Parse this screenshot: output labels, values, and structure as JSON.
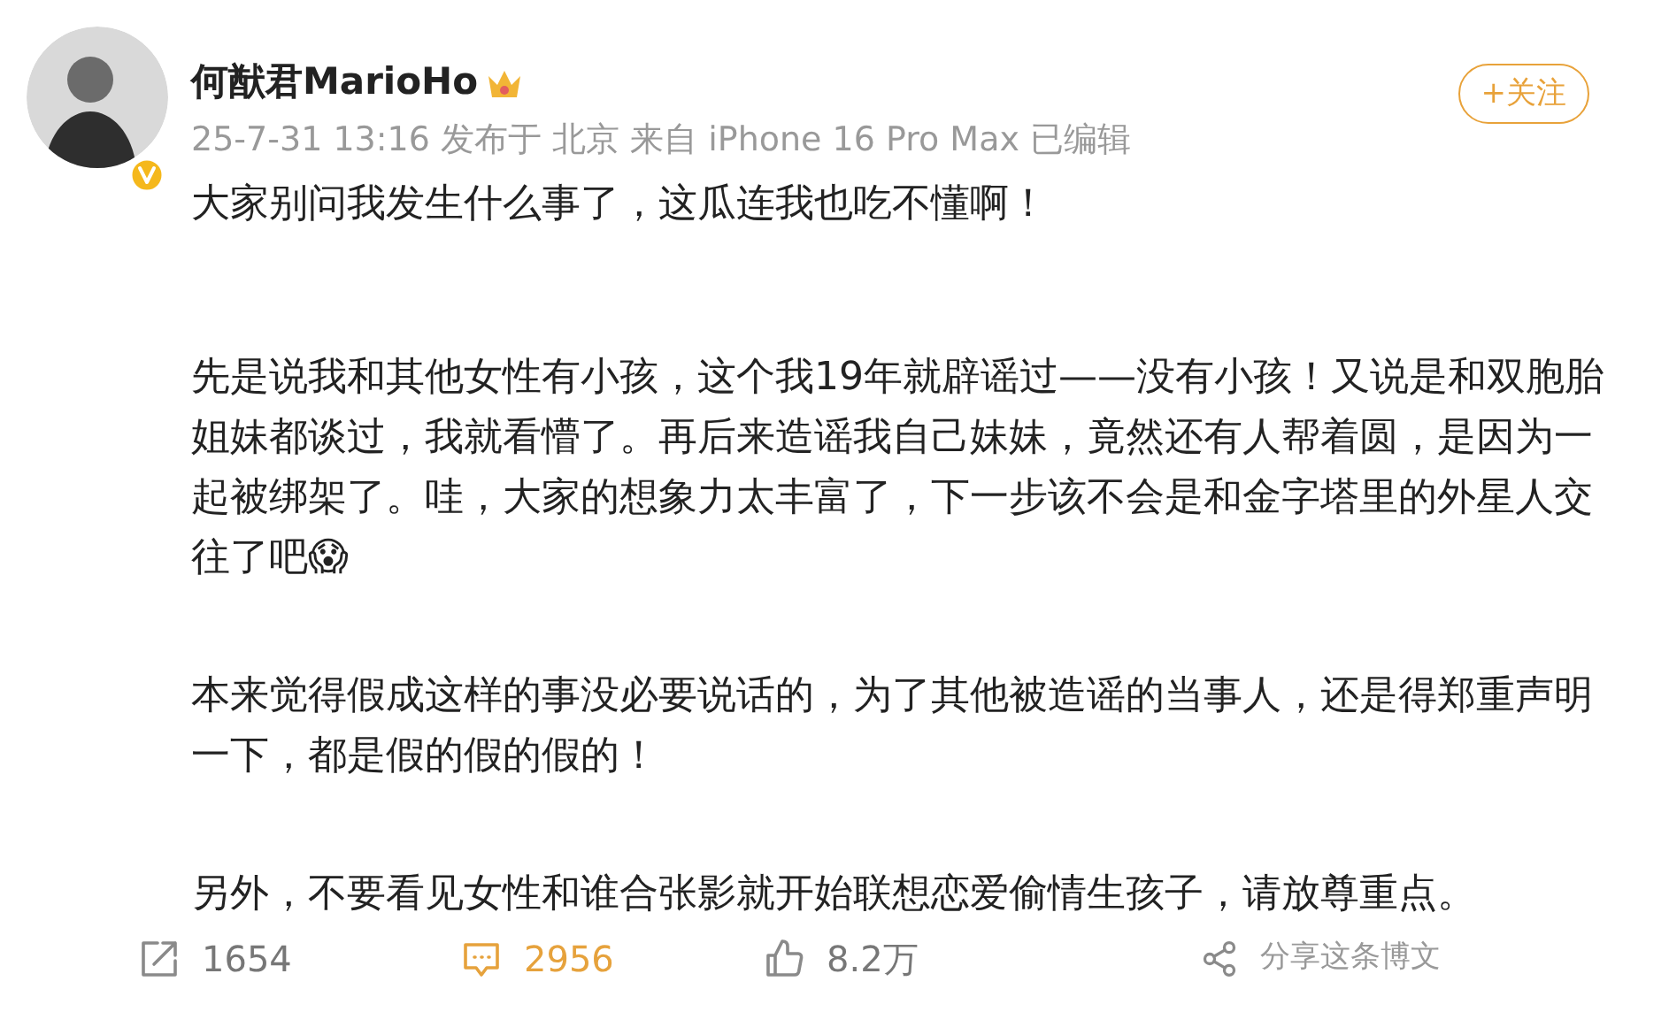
{
  "post": {
    "author": "何猷君MarioHo",
    "verified": true,
    "meta": "25-7-31 13:16 发布于 北京 来自 iPhone 16 Pro Max 已编辑",
    "follow_button": "+关注",
    "paragraphs": [
      "大家别问我发生什么事了，这瓜连我也吃不懂啊！",
      "先是说我和其他女性有小孩，这个我19年就辟谣过——没有小孩！又说是和双胞胎姐妹都谈过，我就看懵了。再后来造谣我自己妹妹，竟然还有人帮着圆，是因为一起被绑架了。哇，大家的想象力太丰富了，下一步该不会是和金字塔里的外星人交往了吧😱",
      "本来觉得假成这样的事没必要说话的，为了其他被造谣的当事人，还是得郑重声明一下，都是假的假的假的！",
      "另外，不要看见女性和谁合张影就开始联想恋爱偷情生孩子，请放尊重点。"
    ]
  },
  "actions": [
    {
      "kind": "repost",
      "label": "1654",
      "selected": false
    },
    {
      "kind": "comment",
      "label": "2956",
      "selected": true
    },
    {
      "kind": "like",
      "label": "8.2万",
      "selected": false
    },
    {
      "kind": "share",
      "label": "分享这条博文",
      "selected": false
    }
  ]
}
